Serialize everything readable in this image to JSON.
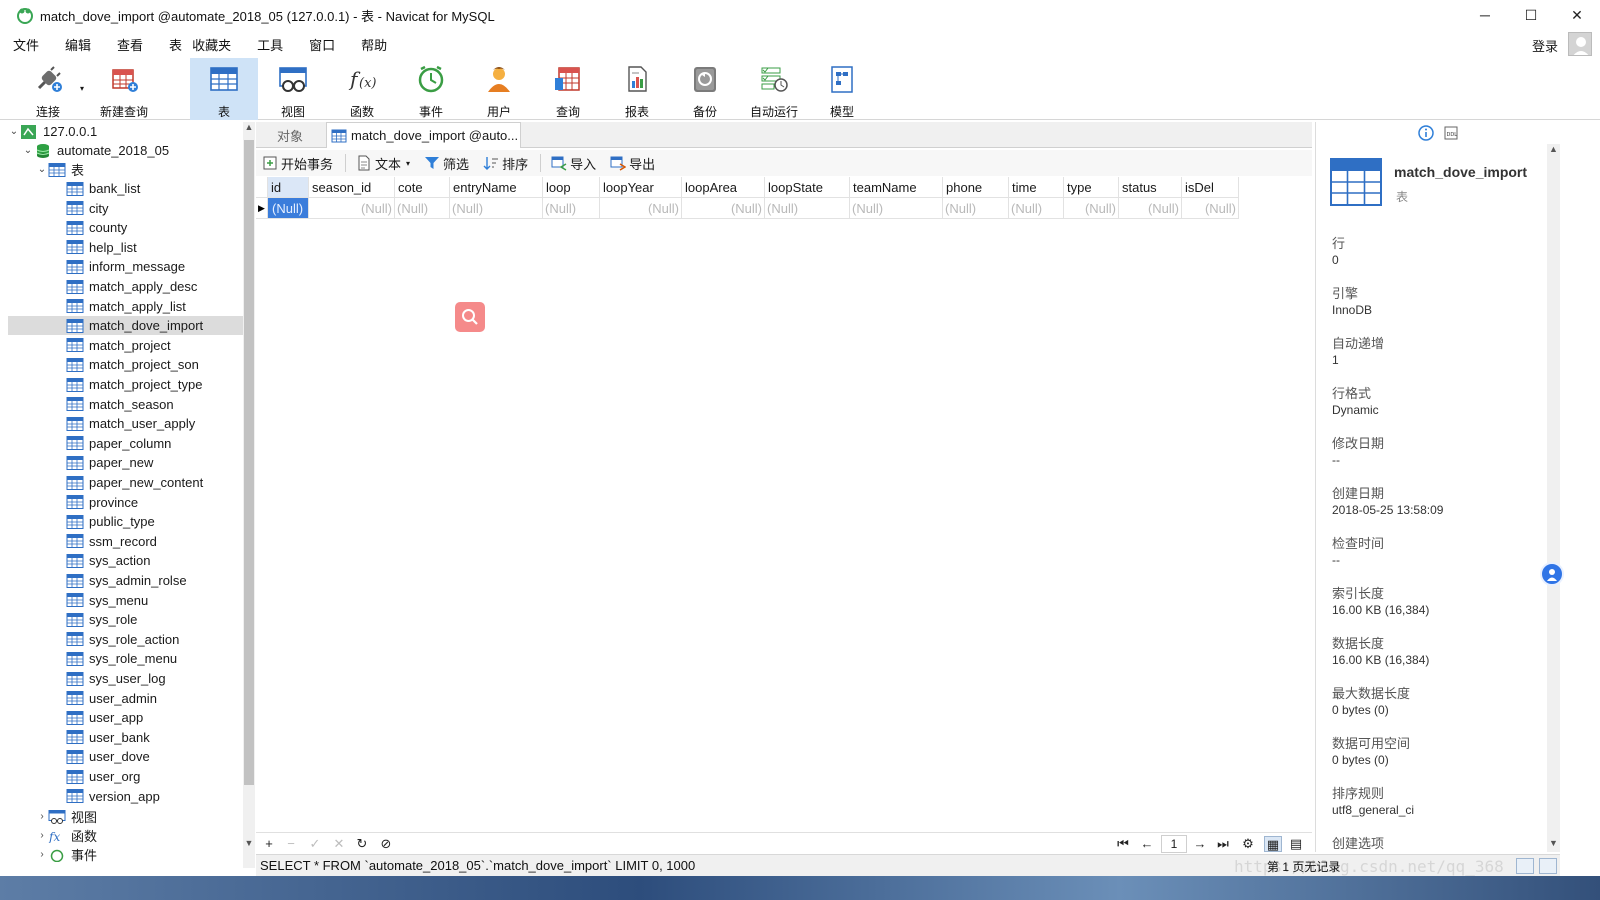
{
  "window": {
    "title": "match_dove_import @automate_2018_05 (127.0.0.1) - 表 - Navicat for MySQL",
    "controls": [
      "─",
      "☐",
      "✕"
    ]
  },
  "menu": {
    "items": [
      "文件",
      "编辑",
      "查看",
      "表",
      "收藏夹",
      "工具",
      "窗口",
      "帮助"
    ],
    "login": "登录"
  },
  "toolbar": {
    "items": [
      {
        "label": "连接",
        "icon": "plug-icon"
      },
      {
        "label": "新建查询",
        "icon": "new-query-icon"
      },
      {
        "label": "表",
        "icon": "table-icon",
        "active": true
      },
      {
        "label": "视图",
        "icon": "view-icon"
      },
      {
        "label": "函数",
        "icon": "function-icon"
      },
      {
        "label": "事件",
        "icon": "clock-icon"
      },
      {
        "label": "用户",
        "icon": "user-icon"
      },
      {
        "label": "查询",
        "icon": "query-icon"
      },
      {
        "label": "报表",
        "icon": "report-icon"
      },
      {
        "label": "备份",
        "icon": "backup-icon"
      },
      {
        "label": "自动运行",
        "icon": "schedule-icon"
      },
      {
        "label": "模型",
        "icon": "model-icon"
      }
    ]
  },
  "tree": {
    "connection": "127.0.0.1",
    "database": "automate_2018_05",
    "tables_group": "表",
    "tables": [
      "bank_list",
      "city",
      "county",
      "help_list",
      "inform_message",
      "match_apply_desc",
      "match_apply_list",
      "match_dove_import",
      "match_project",
      "match_project_son",
      "match_project_type",
      "match_season",
      "match_user_apply",
      "paper_column",
      "paper_new",
      "paper_new_content",
      "province",
      "public_type",
      "ssm_record",
      "sys_action",
      "sys_admin_rolse",
      "sys_menu",
      "sys_role",
      "sys_role_action",
      "sys_role_menu",
      "sys_user_log",
      "user_admin",
      "user_app",
      "user_bank",
      "user_dove",
      "user_org",
      "version_app"
    ],
    "selected": "match_dove_import",
    "views_group": "视图",
    "functions_group": "函数",
    "events_group": "事件"
  },
  "tabs": {
    "objects": "对象",
    "current": "match_dove_import @auto..."
  },
  "subtoolbar": {
    "begin_tx": "开始事务",
    "text": "文本",
    "filter": "筛选",
    "sort": "排序",
    "import": "导入",
    "export": "导出"
  },
  "grid": {
    "columns": [
      "id",
      "season_id",
      "cote",
      "entryName",
      "loop",
      "loopYear",
      "loopArea",
      "loopState",
      "teamName",
      "phone",
      "time",
      "type",
      "status",
      "isDel"
    ],
    "null_text": "(Null)"
  },
  "pager": {
    "page": "1"
  },
  "info": {
    "name": "match_dove_import",
    "type": "表",
    "properties": [
      {
        "label": "行",
        "value": "0"
      },
      {
        "label": "引擎",
        "value": "InnoDB"
      },
      {
        "label": "自动递增",
        "value": "1"
      },
      {
        "label": "行格式",
        "value": "Dynamic"
      },
      {
        "label": "修改日期",
        "value": "--"
      },
      {
        "label": "创建日期",
        "value": "2018-05-25 13:58:09"
      },
      {
        "label": "检查时间",
        "value": "--"
      },
      {
        "label": "索引长度",
        "value": "16.00 KB (16,384)"
      },
      {
        "label": "数据长度",
        "value": "16.00 KB (16,384)"
      },
      {
        "label": "最大数据长度",
        "value": "0 bytes (0)"
      },
      {
        "label": "数据可用空间",
        "value": "0 bytes (0)"
      },
      {
        "label": "排序规则",
        "value": "utf8_general_ci"
      },
      {
        "label": "创建选项",
        "value": ""
      }
    ]
  },
  "status": {
    "sql": "SELECT * FROM `automate_2018_05`.`match_dove_import` LIMIT 0, 1000",
    "watermark": "https://blog.csdn.net/qq_368",
    "page_info": "第 1 页无记录"
  },
  "colors": {
    "accent": "#3b7ddb",
    "selected_tool": "#cfe3f7",
    "table_icon_blue": "#2f6fc4"
  }
}
